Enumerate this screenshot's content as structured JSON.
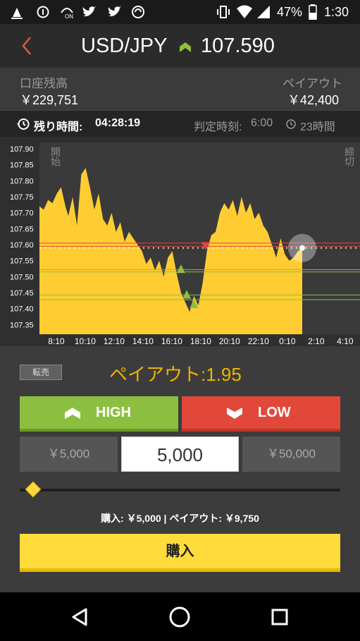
{
  "status_bar": {
    "battery": "47%",
    "time": "1:30",
    "icons": [
      "notification-icon",
      "info-icon",
      "on-icon",
      "twitter-icon",
      "twitter-icon",
      "sync-icon",
      "vibrate-icon",
      "wifi-icon",
      "signal-icon",
      "battery-icon"
    ]
  },
  "header": {
    "back_icon": "chevron-left-icon",
    "pair": "USD/JPY",
    "direction_icon": "up-arrow-icon",
    "rate": "107.590"
  },
  "balance": {
    "account_label": "口座残高",
    "account_value": "￥229,751",
    "payout_label": "ペイアウト",
    "payout_value": "￥42,400"
  },
  "timebar": {
    "remaining_label": "残り時間:",
    "remaining_value": "04:28:19",
    "judgement_label": "判定時刻:",
    "judgement_value": "6:00",
    "duration": "23時間"
  },
  "chart_data": {
    "type": "area",
    "y_ticks": [
      "107.90",
      "107.85",
      "107.80",
      "107.75",
      "107.70",
      "107.65",
      "107.60",
      "107.55",
      "107.50",
      "107.45",
      "107.40",
      "107.35"
    ],
    "ylim": [
      107.32,
      107.92
    ],
    "x_ticks": [
      "8:10",
      "10:10",
      "12:10",
      "14:10",
      "16:10",
      "18:10",
      "20:10",
      "22:10",
      "0:10",
      "2:10",
      "4:10"
    ],
    "x_tick_hours": [
      8.1667,
      10.1667,
      12.1667,
      14.1667,
      16.1667,
      18.1667,
      20.1667,
      22.1667,
      24.1667,
      26.1667,
      28.1667
    ],
    "xlim": [
      7.0,
      29.2
    ],
    "start_label": "開始",
    "end_label": "締切",
    "series": [
      {
        "x": [
          7.0,
          7.3,
          7.6,
          7.9,
          8.2,
          8.5,
          8.8,
          9.0,
          9.3,
          9.6,
          9.9,
          10.2,
          10.5,
          10.8,
          11.1,
          11.4,
          11.7,
          12.0,
          12.3,
          12.6,
          12.9,
          13.2,
          13.5,
          13.8,
          14.1,
          14.4,
          14.7,
          15.0,
          15.3,
          15.6,
          15.9,
          16.2,
          16.5,
          16.8,
          17.1,
          17.4,
          17.7,
          18.0,
          18.3,
          18.6,
          18.9,
          19.2,
          19.5,
          19.8,
          20.1,
          20.4,
          20.7,
          21.0,
          21.3,
          21.6,
          21.9,
          22.2,
          22.5,
          22.8,
          23.1,
          23.4,
          23.7,
          24.0,
          24.3,
          24.6,
          24.9,
          25.2
        ],
        "y": [
          107.72,
          107.71,
          107.74,
          107.73,
          107.76,
          107.78,
          107.72,
          107.69,
          107.75,
          107.66,
          107.82,
          107.84,
          107.78,
          107.71,
          107.76,
          107.68,
          107.66,
          107.7,
          107.64,
          107.67,
          107.61,
          107.64,
          107.62,
          107.6,
          107.58,
          107.54,
          107.56,
          107.52,
          107.55,
          107.5,
          107.56,
          107.58,
          107.51,
          107.45,
          107.42,
          107.39,
          107.44,
          107.41,
          107.48,
          107.58,
          107.63,
          107.64,
          107.7,
          107.73,
          107.71,
          107.74,
          107.69,
          107.75,
          107.7,
          107.73,
          107.68,
          107.7,
          107.66,
          107.64,
          107.6,
          107.56,
          107.62,
          107.57,
          107.55,
          107.56,
          107.58,
          107.59
        ]
      }
    ],
    "trade_markers": [
      {
        "type": "low",
        "x": 18.5,
        "y": 107.595
      },
      {
        "type": "high",
        "x": 16.8,
        "y": 107.525
      },
      {
        "type": "high",
        "x": 17.2,
        "y": 107.445
      },
      {
        "type": "high",
        "x": 17.7,
        "y": 107.415
      }
    ],
    "reference_lines": [
      {
        "color": "#e2483a",
        "y": 107.605
      },
      {
        "color": "#e2483a",
        "y": 107.595
      },
      {
        "color": "#8cbf3f",
        "y": 107.522
      },
      {
        "color": "#8cbf3f",
        "y": 107.515
      },
      {
        "color": "#8cbf3f",
        "y": 107.443
      },
      {
        "color": "#8cbf3f",
        "y": 107.428
      }
    ],
    "current_value": 107.59
  },
  "controls": {
    "resale_label": "転売",
    "payout_rate": "ペイアウト:1.95",
    "high_label": "HIGH",
    "low_label": "LOW",
    "high_icon": "up-arrow-icon",
    "low_icon": "down-arrow-icon",
    "amount_min": "￥5,000",
    "amount_value": "5,000",
    "amount_max": "￥50,000",
    "slider_level": 0.03,
    "summary": "購入: ￥5,000  | ペイアウト: ￥9,750",
    "buy_label": "購入"
  },
  "navbar": {
    "icons": [
      "back-icon",
      "home-icon",
      "recents-icon"
    ]
  }
}
